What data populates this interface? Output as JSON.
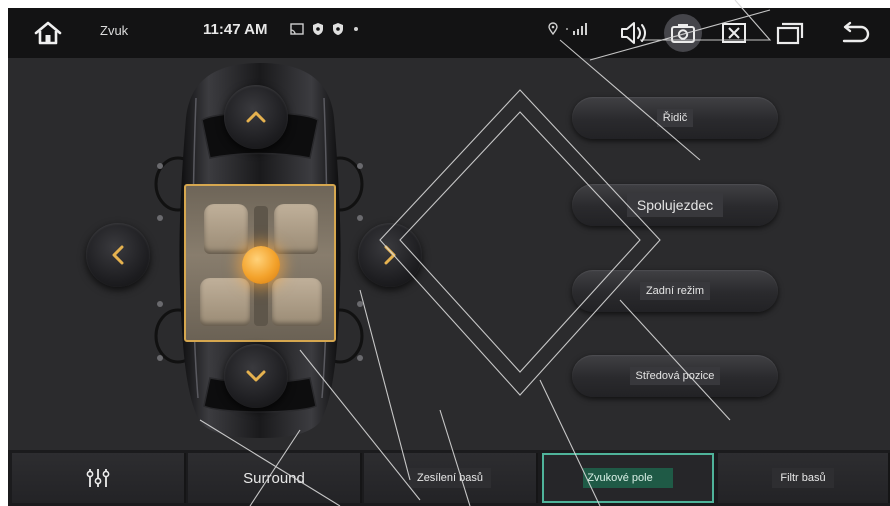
{
  "status_bar": {
    "title": "Zvuk",
    "time": "11:47 AM",
    "icons": [
      "home-icon",
      "cast-icon",
      "shield-icon",
      "shield-icon",
      "dot-icon",
      "location-icon",
      "signal-icon",
      "volume-icon",
      "screenshot-icon",
      "close-app-icon",
      "recents-icon",
      "back-icon"
    ]
  },
  "car_controls": {
    "arrows": [
      "chevron-up-icon",
      "chevron-down-icon",
      "chevron-left-icon",
      "chevron-right-icon"
    ],
    "accent_color": "#d6a74f",
    "focus_color": "#f3a22b"
  },
  "presets": [
    {
      "label": "Řidič"
    },
    {
      "label": "Spolujezdec"
    },
    {
      "label": "Zadní režim"
    },
    {
      "label": "Středová pozice"
    }
  ],
  "tabs": [
    {
      "icon": "equalizer-icon",
      "label": ""
    },
    {
      "label": "Surround"
    },
    {
      "label": "Zesílení basů"
    },
    {
      "label": "Zvukové pole",
      "active": true
    },
    {
      "label": "Filtr basů"
    }
  ],
  "colors": {
    "active_tab_border": "#4fb39a",
    "active_tab_fill": "#1f5a46",
    "background": "#2b2b2d"
  }
}
